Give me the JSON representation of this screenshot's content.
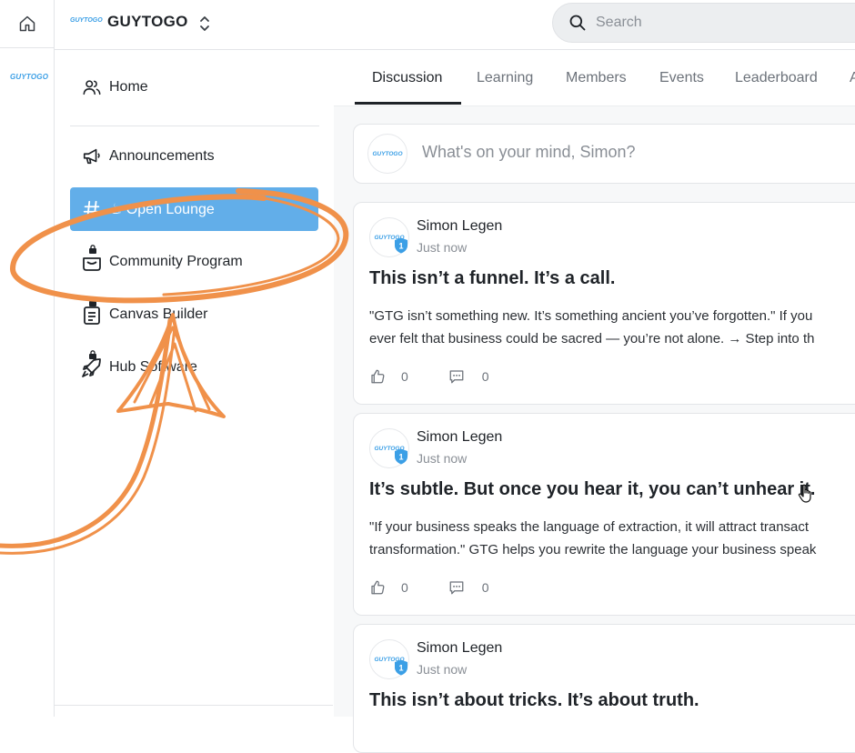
{
  "brand": {
    "logo_text": "GUYTOGO",
    "name": "GUYTOGO"
  },
  "rail": {
    "logo_text": "GUYTOGO"
  },
  "search": {
    "placeholder": "Search",
    "value": ""
  },
  "nav": {
    "items": [
      {
        "label": "Home",
        "icon": "users-icon"
      },
      {
        "label": "Announcements",
        "icon": "megaphone-icon"
      },
      {
        "label": "☕ Open Lounge",
        "icon": "hash-icon",
        "active": true
      },
      {
        "label": "Community Program",
        "icon": "bag-icon",
        "locked": true
      },
      {
        "label": "Canvas Builder",
        "icon": "clipboard-icon",
        "locked": true
      },
      {
        "label": "Hub Software",
        "icon": "rocket-icon",
        "locked": true
      }
    ]
  },
  "tabs": [
    {
      "label": "Discussion",
      "active": true
    },
    {
      "label": "Learning"
    },
    {
      "label": "Members"
    },
    {
      "label": "Events"
    },
    {
      "label": "Leaderboard"
    },
    {
      "label": "A"
    }
  ],
  "composer": {
    "avatar_text": "GUYTOGO",
    "prompt": "What's on your mind, Simon?"
  },
  "posts": [
    {
      "author": "Simon Legen",
      "time": "Just now",
      "level": "1",
      "avatar_text": "GUYTOGO",
      "title": "This isn’t a funnel. It’s a call.",
      "body_line1": "\"GTG isn’t something new. It’s something ancient you’ve forgotten.\" If you",
      "body_line2": "ever felt that business could be sacred — you’re not alone. → Step into th",
      "likes": "0",
      "comments": "0"
    },
    {
      "author": "Simon Legen",
      "time": "Just now",
      "level": "1",
      "avatar_text": "GUYTOGO",
      "title": "It’s subtle. But once you hear it, you can’t unhear it.",
      "body_line1": "\"If your business speaks the language of extraction, it will attract transact",
      "body_line2": "transformation.\" GTG helps you rewrite the language your business speak",
      "likes": "0",
      "comments": "0"
    },
    {
      "author": "Simon Legen",
      "time": "Just now",
      "level": "1",
      "avatar_text": "GUYTOGO",
      "title": "This isn’t about tricks. It’s about truth."
    }
  ],
  "colors": {
    "accent": "#62aee9",
    "logo_blue": "#3b9fe6",
    "annotation": "#f0914a"
  }
}
